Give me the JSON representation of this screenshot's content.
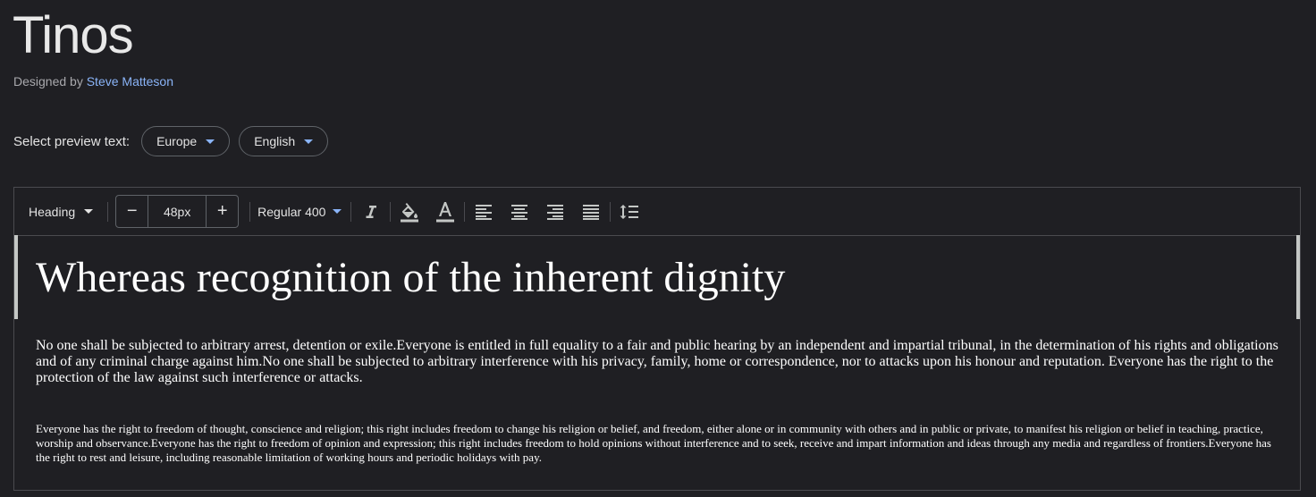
{
  "font": {
    "name": "Tinos",
    "designed_by_label": "Designed by",
    "designer": "Steve Matteson"
  },
  "preview_text": {
    "label": "Select preview text:",
    "region": "Europe",
    "language": "English"
  },
  "toolbar": {
    "style": "Heading",
    "size_value": "48px",
    "decrease_label": "−",
    "increase_label": "+",
    "weight": "Regular 400",
    "icons": [
      "italic-icon",
      "fill-color-icon",
      "text-color-icon",
      "align-left-icon",
      "align-center-icon",
      "align-right-icon",
      "align-justify-icon",
      "line-height-icon"
    ]
  },
  "preview": {
    "heading": "Whereas recognition of the inherent dignity",
    "paragraph1": "No one shall be subjected to arbitrary arrest, detention or exile.Everyone is entitled in full equality to a fair and public hearing by an independent and impartial tribunal, in the determination of his rights and obligations and of any criminal charge against him.No one shall be subjected to arbitrary interference with his privacy, family, home or correspondence, nor to attacks upon his honour and reputation. Everyone has the right to the protection of the law against such interference or attacks.",
    "paragraph2": "Everyone has the right to freedom of thought, conscience and religion; this right includes freedom to change his religion or belief, and freedom, either alone or in community with others and in public or private, to manifest his religion or belief in teaching, practice, worship and observance.Everyone has the right to freedom of opinion and expression; this right includes freedom to hold opinions without interference and to seek, receive and impart information and ideas through any media and regardless of frontiers.Everyone has the right to rest and leisure, including reasonable limitation of working hours and periodic holidays with pay."
  },
  "colors": {
    "background": "#1f1f23",
    "accent": "#8ab4f8",
    "text": "#e3e3e3"
  }
}
